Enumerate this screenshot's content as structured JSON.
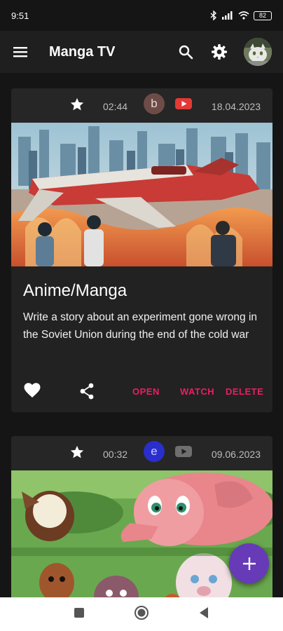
{
  "status_bar": {
    "time": "9:51",
    "battery": "82"
  },
  "app_bar": {
    "title": "Manga TV",
    "icons": [
      "menu-icon",
      "search-icon",
      "settings-icon",
      "avatar"
    ]
  },
  "cards": [
    {
      "duration": "02:44",
      "badge_letter": "b",
      "badge_color": "#6d4c48",
      "video_icon_color": "#e53935",
      "date": "18.04.2023",
      "title": "Anime/Manga",
      "description": "Write a story about an experiment gone wrong in the Soviet Union during the end of the cold war",
      "actions": {
        "open": "OPEN",
        "watch": "WATCH",
        "delete": "DELETE"
      }
    },
    {
      "duration": "00:32",
      "badge_letter": "e",
      "badge_color": "#2a2ecc",
      "video_icon_color": "#6f6f6f",
      "date": "09.06.2023"
    }
  ],
  "fab": {
    "label": "+",
    "color": "#673ab7"
  },
  "colors": {
    "accent": "#e91e63",
    "background": "#151515",
    "card": "#222222"
  }
}
